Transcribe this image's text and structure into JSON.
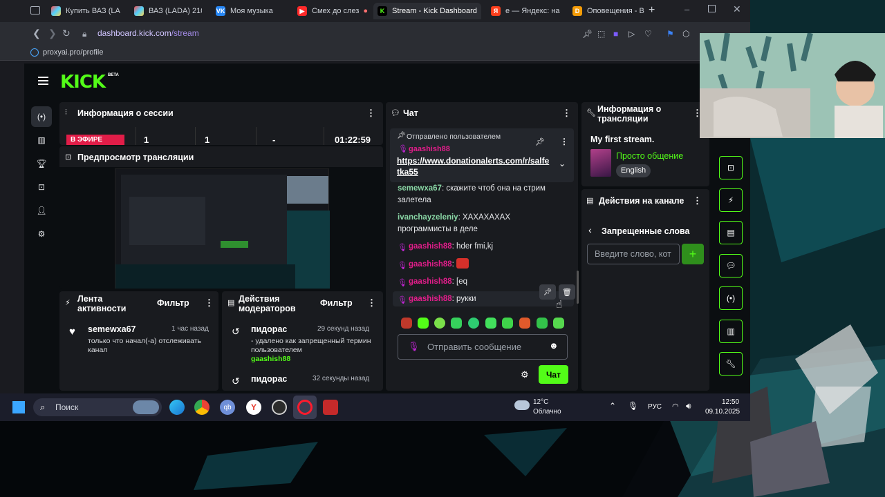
{
  "browser": {
    "tabs": [
      {
        "label": "Купить ВАЗ (LA",
        "icon": "color-dots-icon"
      },
      {
        "label": "ВАЗ (LADA) 210",
        "icon": "color-dots-icon"
      },
      {
        "label": "Моя музыка",
        "icon": "vk-icon"
      },
      {
        "label": "Смех до слез",
        "icon": "youtube-icon"
      },
      {
        "label": "Stream - Kick Dashboard",
        "icon": "kick-icon"
      },
      {
        "label": "е — Яндекс: на",
        "icon": "yandex-icon"
      },
      {
        "label": "Оповещения - В",
        "icon": "donation-icon"
      }
    ],
    "url_host": "dashboard.kick.com",
    "url_path": "/stream",
    "bookmark": "proxyai.pro/profile"
  },
  "kick": {
    "logo": "KICK",
    "beta": "BETA",
    "session": {
      "title": "Информация о сессии",
      "live_badge": "В ЭФИРЕ",
      "stats": [
        "1",
        "1",
        "-",
        "01:22:59"
      ]
    },
    "preview": {
      "title": "Предпросмотр трансляции"
    },
    "activity": {
      "title": "Лента активности",
      "filter": "Фильтр",
      "items": [
        {
          "user": "semewxa67",
          "time": "1 час назад",
          "text": "только что начал(-а) отслеживать канал"
        }
      ]
    },
    "mod_actions": {
      "title": "Действия модераторов",
      "filter": "Фильтр",
      "items": [
        {
          "user": "пидорас",
          "time": "29 секунд назад",
          "text": "- удалено как запрещенный термин пользователем",
          "target": "gaashish88"
        },
        {
          "user": "пидорас",
          "time": "32 секунды назад"
        }
      ]
    },
    "chat": {
      "title": "Чат",
      "pinned_label": "Отправлено пользователем",
      "pinned_user": "gaashish88",
      "pinned_link": "https://www.donationalerts.com/r/salfetka55",
      "messages": [
        {
          "user": "semewxa67",
          "text": "скажите чтоб она на стрим"
        },
        {
          "user": "",
          "text": "залетела"
        },
        {
          "user": "ivanchayzeleniy",
          "text": "ХАХАХАХАХ"
        },
        {
          "user": "",
          "text": "программисты в деле"
        },
        {
          "user": "gaashish88",
          "text": "hder fmi,kj"
        },
        {
          "user": "gaashish88",
          "text": ""
        },
        {
          "user": "gaashish88",
          "text": "[eq"
        },
        {
          "user": "gaashish88",
          "text": "рукки"
        }
      ],
      "input_placeholder": "Отправить сообщение",
      "send_label": "Чат"
    },
    "stream_info": {
      "title": "Информация о трансляции",
      "stream_title": "My first stream.",
      "category": "Просто общение",
      "language": "English"
    },
    "channel_actions": {
      "title": "Действия на канале",
      "banned_words": "Запрещенные слова",
      "input_placeholder": "Введите слово, кот"
    }
  },
  "taskbar": {
    "search": "Поиск",
    "weather_temp": "12°C",
    "weather_desc": "Облачно",
    "lang": "РУС",
    "time": "12:50",
    "date": "09.10.2025"
  },
  "colors": {
    "kick_green": "#53fc18",
    "accent_pink": "#e11d8a",
    "panel": "#191b1f"
  }
}
